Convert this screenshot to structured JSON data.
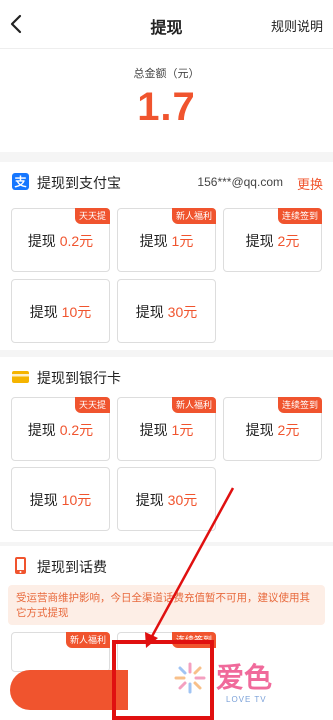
{
  "header": {
    "title": "提现",
    "rules_label": "规则说明"
  },
  "total": {
    "label": "总金额（元）",
    "amount": "1.7"
  },
  "alipay": {
    "title": "提现到支付宝",
    "account": "156***@qq.com",
    "change_label": "更换",
    "options": [
      {
        "prefix": "提现",
        "amount": "0.2元",
        "badge": "天天提"
      },
      {
        "prefix": "提现",
        "amount": "1元",
        "badge": "新人福利"
      },
      {
        "prefix": "提现",
        "amount": "2元",
        "badge": "连续签到"
      },
      {
        "prefix": "提现",
        "amount": "10元",
        "badge": ""
      },
      {
        "prefix": "提现",
        "amount": "30元",
        "badge": ""
      }
    ]
  },
  "bank": {
    "title": "提现到银行卡",
    "options": [
      {
        "prefix": "提现",
        "amount": "0.2元",
        "badge": "天天提"
      },
      {
        "prefix": "提现",
        "amount": "1元",
        "badge": "新人福利"
      },
      {
        "prefix": "提现",
        "amount": "2元",
        "badge": "连续签到"
      },
      {
        "prefix": "提现",
        "amount": "10元",
        "badge": ""
      },
      {
        "prefix": "提现",
        "amount": "30元",
        "badge": ""
      }
    ]
  },
  "phone": {
    "title": "提现到话费",
    "notice": "受运营商维护影响，今日全渠道话费充值暂不可用，建议使用其它方式提现",
    "badges": [
      "新人福利",
      "连续签到"
    ]
  },
  "watermark": {
    "text": "爱色",
    "sub": "LOVE TV"
  },
  "colors": {
    "accent": "#f0542e",
    "alipay_blue": "#1677ff",
    "bank_yellow": "#f5b400",
    "annotation_red": "#e01010"
  },
  "icons": [
    "back-arrow-icon",
    "alipay-icon",
    "bank-card-icon",
    "phone-icon"
  ]
}
